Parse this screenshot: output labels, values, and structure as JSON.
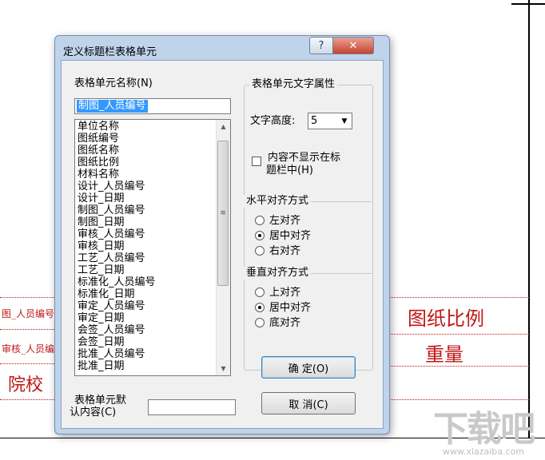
{
  "background": {
    "cad_labels": [
      "图纸比例",
      "重量",
      "院校"
    ],
    "cad_partial_labels": [
      "图_人员编号",
      "审核_人员编号"
    ],
    "watermark_main": "下载吧",
    "watermark_sub": "www.xiazaiba.com"
  },
  "dialog": {
    "title": "定义标题栏表格单元",
    "help_label": "?",
    "close_label": "✕",
    "cell_name_label": "表格单元名称(N)",
    "cell_name_value": "制图_人员编号",
    "list_items": [
      "单位名称",
      "图纸编号",
      "图纸名称",
      "图纸比例",
      "材料名称",
      "设计_人员编号",
      "设计_日期",
      "制图_人员编号",
      "制图_日期",
      "审核_人员编号",
      "审核_日期",
      "工艺_人员编号",
      "工艺_日期",
      "标准化_人员编号",
      "标准化_日期",
      "审定_人员编号",
      "审定_日期",
      "会签_人员编号",
      "会签_日期",
      "批准_人员编号",
      "批准_日期"
    ],
    "text_props_group": "表格单元文字属性",
    "text_height_label": "文字高度:",
    "text_height_value": "5",
    "hide_content_label_line1": "内容不显示在标",
    "hide_content_label_line2": "题栏中(H)",
    "hide_content_checked": false,
    "h_align_group": "水平对齐方式",
    "h_align_options": [
      "左对齐",
      "居中对齐",
      "右对齐"
    ],
    "h_align_selected": "居中对齐",
    "v_align_group": "垂直对齐方式",
    "v_align_options": [
      "上对齐",
      "居中对齐",
      "底对齐"
    ],
    "v_align_selected": "居中对齐",
    "ok_label": "确  定(O)",
    "cancel_label": "取  消(C)",
    "default_content_label_line1": "表格单元默",
    "default_content_label_line2": "认内容(C)",
    "default_content_value": ""
  },
  "colors": {
    "cad_red": "#c01818",
    "dialog_frame": "#bfd3ea",
    "client_bg": "#f0f0f0",
    "selection": "#3399ff",
    "close_button": "#c7432c"
  }
}
